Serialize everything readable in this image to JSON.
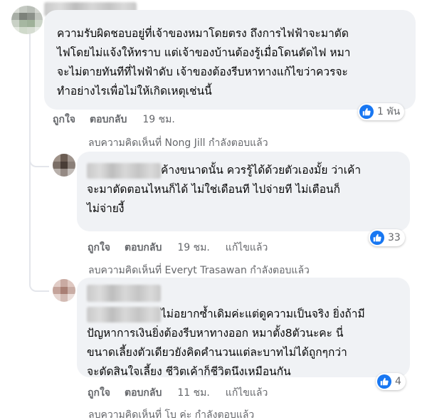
{
  "comments": [
    {
      "lines": [
        "ความรับผิดชอบอยู่ที่เจ้าของหมาโดยตรง ถึงการไฟฟ้าจะมาตัด",
        "ไฟโดยไม่แจ้งให้ทราบ แต่เจ้าของบ้านต้องรู้เมื่อโดนตัดไฟ หมา",
        "จะไม่ตายทันทีที่ไฟฟ้าดับ เจ้าของต้องรีบหาทางแก้ไขว่าควรจะ",
        "ทำอย่างไรเพื่อไม่ให้เกิดเหตุเช่นนี้"
      ],
      "reaction_count": "1 พัน",
      "like_label": "ถูกใจ",
      "reply_label": "ตอบกลับ",
      "time": "19 ชม.",
      "edited": "",
      "deleted_notice": "ลบความคิดเห็นที่ Nong Jill กำลังตอบแล้ว"
    },
    {
      "first_line": "ค้างขนาดนั้น ควรรู้ได้ด้วยตัวเองมั้ย ว่าเค้า",
      "lines": [
        "จะมาตัดตอนไหนก็ได้ ไม่ใช่เดือนที ไปจ่ายที ไม่เตือนก็",
        "ไม่จ่ายงี้"
      ],
      "reaction_count": "33",
      "like_label": "ถูกใจ",
      "reply_label": "ตอบกลับ",
      "time": "19 ชม.",
      "edited": "แก้ไขแล้ว",
      "deleted_notice": "ลบความคิดเห็นที่ Everyt Trasawan กำลังตอบแล้ว"
    },
    {
      "first_line": "ไม่อยากซ้ำเดิมค่ะแต่ดูความเป็นจริง ยิ่งถ้ามี",
      "lines": [
        "ปัญหาการเงินยิ่งต้องรีบหาทางออก หมาตั้ง8ตัวนะคะ นี่",
        "ขนาดเลี้ยงตัวเดียวยังคิดคำนวนแต่ละบาทไม่ได้ถูกๆกว่า",
        "จะตัดสินใจเลี้ยง ชีวิตเค้าก็ชีวิตนึงเหมือนกัน"
      ],
      "reaction_count": "4",
      "like_label": "ถูกใจ",
      "reply_label": "ตอบกลับ",
      "time": "11 ชม.",
      "edited": "แก้ไขแล้ว",
      "deleted_notice": "ลบความคิดเห็นที่ โบ ค่ะ กำลังตอบแล้ว"
    }
  ],
  "colors": {
    "bubble": "#f0f2f5",
    "meta_text": "#65676b",
    "like_blue": "#1877f2"
  },
  "icons": {
    "reaction": "thumbs-up-icon"
  }
}
